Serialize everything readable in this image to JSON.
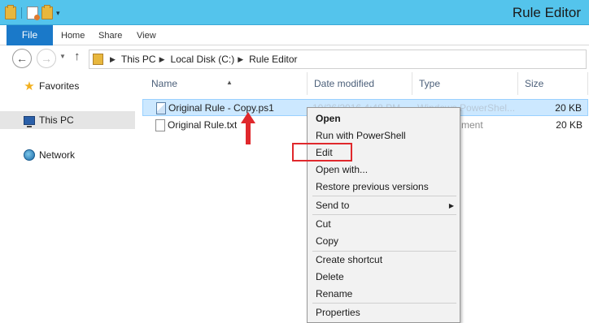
{
  "window": {
    "title": "Rule Editor"
  },
  "ribbon": {
    "tabs": [
      "File",
      "Home",
      "Share",
      "View"
    ]
  },
  "address": {
    "crumbs": [
      "This PC",
      "Local Disk (C:)",
      "Rule Editor"
    ]
  },
  "nav_pane": {
    "items": [
      {
        "label": "Favorites",
        "icon": "star-icon"
      },
      {
        "label": "This PC",
        "icon": "computer-icon",
        "selected": true
      },
      {
        "label": "Network",
        "icon": "network-icon"
      }
    ]
  },
  "file_list": {
    "columns": [
      "Name",
      "Date modified",
      "Type",
      "Size"
    ],
    "rows": [
      {
        "name": "Original Rule - Copy.ps1",
        "date": "10/26/2016 4:48 PM",
        "type": "Windows PowerShel...",
        "size": "20 KB",
        "selected": true
      },
      {
        "name": "Original Rule.txt",
        "date": "",
        "type": "ment",
        "size": "20 KB",
        "selected": false
      }
    ]
  },
  "context_menu": {
    "items": [
      {
        "label": "Open",
        "bold": true
      },
      {
        "label": "Run with PowerShell"
      },
      {
        "label": "Edit",
        "highlighted": true
      },
      {
        "label": "Open with..."
      },
      {
        "label": "Restore previous versions"
      },
      {
        "label": "Send to",
        "submenu": true
      },
      {
        "label": "Cut"
      },
      {
        "label": "Copy"
      },
      {
        "label": "Create shortcut"
      },
      {
        "label": "Delete"
      },
      {
        "label": "Rename"
      },
      {
        "label": "Properties"
      }
    ]
  },
  "colors": {
    "title_bar": "#54c4ec",
    "file_tab": "#1a79c9",
    "selection": "#cce8ff",
    "annotation": "#e0282c"
  }
}
